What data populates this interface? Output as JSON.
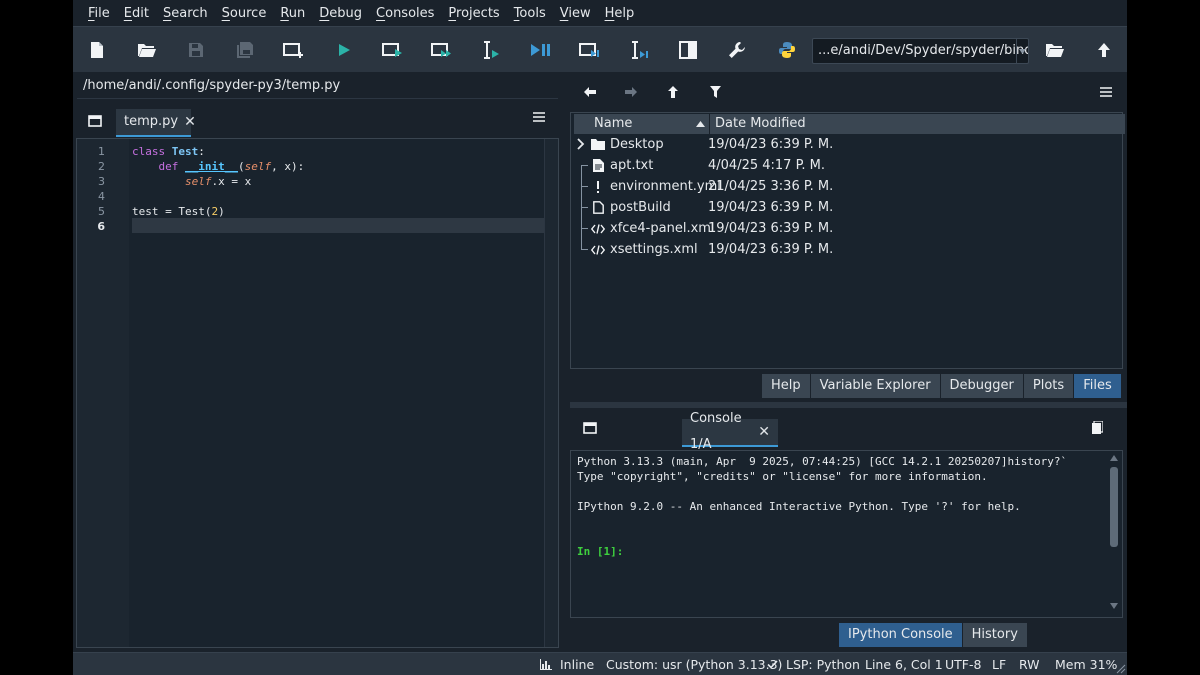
{
  "menu": [
    "File",
    "Edit",
    "Search",
    "Source",
    "Run",
    "Debug",
    "Consoles",
    "Projects",
    "Tools",
    "View",
    "Help"
  ],
  "toolbar": {
    "icons": [
      "new-file-icon",
      "open-file-icon",
      "save-icon",
      "save-all-icon",
      "create-cell-icon",
      "run-icon",
      "run-cell-icon",
      "run-cell-advance-icon",
      "run-selection-icon",
      "debug-icon",
      "debug-cell-icon",
      "debug-selection-icon",
      "maximize-pane-icon",
      "preferences-wrench-icon",
      "python-path-icon"
    ],
    "working_dir": "...e/andi/Dev/Spyder/spyder/binder"
  },
  "editor": {
    "path": "/home/andi/.config/spyder-py3/temp.py",
    "tab_label": "temp.py",
    "close_glyph": "✕",
    "line_numbers": [
      "1",
      "2",
      "3",
      "4",
      "5",
      "6"
    ],
    "current_line": "6",
    "code": {
      "l1_kw": "class",
      "l1_name": "Test",
      "l1_tail": ":",
      "l2_kw": "def",
      "l2_name": "__init__",
      "l2_open": "(",
      "l2_self": "self",
      "l2_tail": ", x):",
      "l3_self": "self",
      "l3_tail": ".x = x",
      "l5_head": "test = Test(",
      "l5_num": "2",
      "l5_tail": ")"
    }
  },
  "files": {
    "columns": [
      "Name",
      "Date Modified"
    ],
    "rows": [
      {
        "name": "Desktop",
        "date": "19/04/23 6:39 P. M.",
        "icon": "folder-icon"
      },
      {
        "name": "apt.txt",
        "date": "4/04/25 4:17 P. M.",
        "icon": "text-file-icon"
      },
      {
        "name": "environment.yml",
        "date": "21/04/25 3:36 P. M.",
        "icon": "exclamation-file-icon"
      },
      {
        "name": "postBuild",
        "date": "19/04/23 6:39 P. M.",
        "icon": "file-icon"
      },
      {
        "name": "xfce4-panel.xml",
        "date": "19/04/23 6:39 P. M.",
        "icon": "code-file-icon"
      },
      {
        "name": "xsettings.xml",
        "date": "19/04/23 6:39 P. M.",
        "icon": "code-file-icon"
      }
    ],
    "bottom_tabs": [
      "Help",
      "Variable Explorer",
      "Debugger",
      "Plots",
      "Files"
    ],
    "active_tab": "Files"
  },
  "console": {
    "tab_label": "Console 1/A",
    "close_glyph": "✕",
    "lines": [
      "Python 3.13.3 (main, Apr  9 2025, 07:44:25) [GCC 14.2.1 20250207]history?`",
      "Type \"copyright\", \"credits\" or \"license\" for more information.",
      "",
      "IPython 9.2.0 -- An enhanced Interactive Python. Type '?' for help.",
      "",
      ""
    ],
    "prompt": "In [1]:",
    "bottom_tabs": [
      "IPython Console",
      "History"
    ],
    "active_tab": "IPython Console"
  },
  "status": {
    "plots": "Inline",
    "interpreter": "Custom: usr (Python 3.13.3)",
    "lsp": "LSP: Python",
    "cursor": "Line 6, Col 1",
    "encoding": "UTF-8",
    "eol": "LF",
    "permissions": "RW",
    "memory": "Mem 31%"
  },
  "colors": {
    "accent": "#3d9ad6",
    "active_tab": "#2f5f8f",
    "prompt": "#3ed03e",
    "background": "#1a222b"
  }
}
